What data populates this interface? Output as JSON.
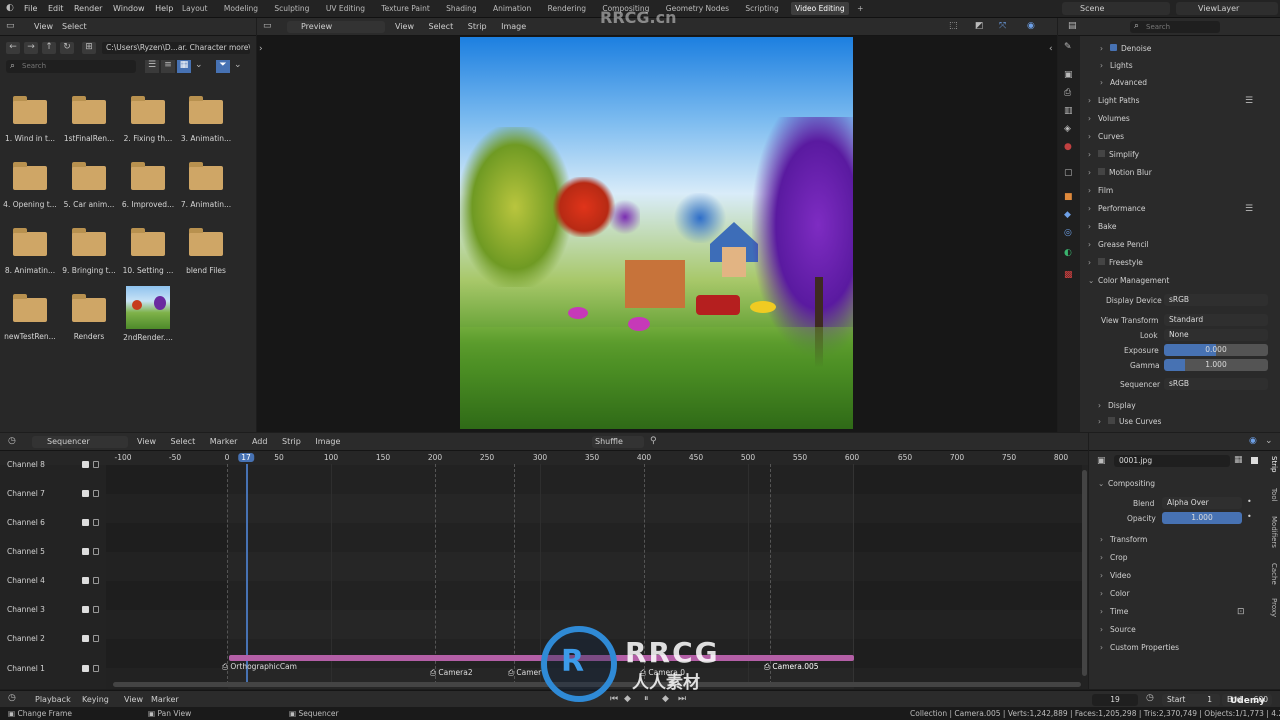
{
  "topbar": {
    "menus": [
      "File",
      "Edit",
      "Render",
      "Window",
      "Help"
    ],
    "workspaces": [
      "Layout",
      "Modeling",
      "Sculpting",
      "UV Editing",
      "Texture Paint",
      "Shading",
      "Animation",
      "Rendering",
      "Compositing",
      "Geometry Nodes",
      "Scripting",
      "Video Editing"
    ],
    "active_workspace": "Video Editing",
    "scene": "Scene",
    "view_layer": "ViewLayer"
  },
  "filebrowser": {
    "menus": [
      "View",
      "Select"
    ],
    "path": "C:\\Users\\Ryzen\\D...ar. Character more\\",
    "search_placeholder": "Search",
    "items": [
      {
        "label": "1. Wind in t...",
        "kind": "folder"
      },
      {
        "label": "1stFinalRen...",
        "kind": "folder"
      },
      {
        "label": "2. Fixing th...",
        "kind": "folder"
      },
      {
        "label": "3. Animatin...",
        "kind": "folder"
      },
      {
        "label": "4. Opening t...",
        "kind": "folder"
      },
      {
        "label": "5. Car anim...",
        "kind": "folder"
      },
      {
        "label": "6. Improved...",
        "kind": "folder"
      },
      {
        "label": "7. Animatin...",
        "kind": "folder"
      },
      {
        "label": "8. Animatin...",
        "kind": "folder"
      },
      {
        "label": "9. Bringing t...",
        "kind": "folder"
      },
      {
        "label": "10. Setting ...",
        "kind": "folder"
      },
      {
        "label": "blend Files",
        "kind": "folder"
      },
      {
        "label": "newTestRen...",
        "kind": "folder"
      },
      {
        "label": "Renders",
        "kind": "folder"
      },
      {
        "label": "2ndRender....",
        "kind": "image"
      }
    ]
  },
  "preview": {
    "mode": "Preview",
    "menus": [
      "View",
      "Select",
      "Strip",
      "Image"
    ]
  },
  "properties": {
    "search_placeholder": "Search",
    "panels": [
      {
        "label": "Denoise",
        "sub": true,
        "checkbox": true
      },
      {
        "label": "Lights",
        "sub": true
      },
      {
        "label": "Advanced",
        "sub": true
      },
      {
        "label": "Light Paths",
        "list": true
      },
      {
        "label": "Volumes"
      },
      {
        "label": "Curves"
      },
      {
        "label": "Simplify",
        "checkbox": false
      },
      {
        "label": "Motion Blur",
        "checkbox": false
      },
      {
        "label": "Film"
      },
      {
        "label": "Performance",
        "list": true
      },
      {
        "label": "Bake"
      },
      {
        "label": "Grease Pencil"
      },
      {
        "label": "Freestyle",
        "checkbox": false
      },
      {
        "label": "Color Management",
        "open": true
      }
    ],
    "color_management": {
      "display_device_label": "Display Device",
      "display_device": "sRGB",
      "view_transform_label": "View Transform",
      "view_transform": "Standard",
      "look_label": "Look",
      "look": "None",
      "exposure_label": "Exposure",
      "exposure": "0.000",
      "gamma_label": "Gamma",
      "gamma": "1.000",
      "sequencer_label": "Sequencer",
      "sequencer": "sRGB",
      "display_label": "Display",
      "use_curves_label": "Use Curves"
    }
  },
  "sequencer": {
    "editor": "Sequencer",
    "menus": [
      "View",
      "Select",
      "Marker",
      "Add",
      "Strip",
      "Image"
    ],
    "overlap_mode": "Shuffle",
    "ruler": [
      "-100",
      "-50",
      "0",
      "17",
      "50",
      "100",
      "150",
      "200",
      "250",
      "300",
      "350",
      "400",
      "450",
      "500",
      "550",
      "600",
      "650",
      "700",
      "750",
      "800"
    ],
    "current_frame": "17",
    "channels": [
      "Channel 8",
      "Channel 7",
      "Channel 6",
      "Channel 5",
      "Channel 4",
      "Channel 3",
      "Channel 2",
      "Channel 1"
    ],
    "strips": [
      {
        "label": "OrthographicCam"
      },
      {
        "label": "Camera2"
      },
      {
        "label": "Camer"
      },
      {
        "label": "Camera.0"
      },
      {
        "label": "Camera.005"
      }
    ]
  },
  "strip_props": {
    "name": "0001.jpg",
    "compositing": "Compositing",
    "blend_label": "Blend",
    "blend": "Alpha Over",
    "opacity_label": "Opacity",
    "opacity": "1.000",
    "panels": [
      "Transform",
      "Crop",
      "Video",
      "Color",
      "Time",
      "Source",
      "Custom Properties"
    ],
    "tabs": [
      "Strip",
      "Tool",
      "Modifiers",
      "Cache",
      "Proxy"
    ]
  },
  "playback": {
    "menus": [
      "Playback",
      "Keying",
      "View",
      "Marker"
    ],
    "frame": "19",
    "start_label": "Start",
    "start": "1",
    "end_label": "End",
    "end": "600"
  },
  "statusbar": {
    "left": [
      "Change Frame",
      "Pan View",
      "Sequencer"
    ],
    "right": "Collection | Camera.005 | Verts:1,242,889 | Faces:1,205,298 | Tris:2,370,749 | Objects:1/1,773 | 4.20"
  },
  "watermarks": {
    "top": "RRCG.cn",
    "logo": "RRCG",
    "logo_sub": "人人素材",
    "udemy": "Udemy"
  },
  "colors": {
    "accent": "#4772b3",
    "strip": "#b35fa6",
    "folder": "#cfa666"
  }
}
